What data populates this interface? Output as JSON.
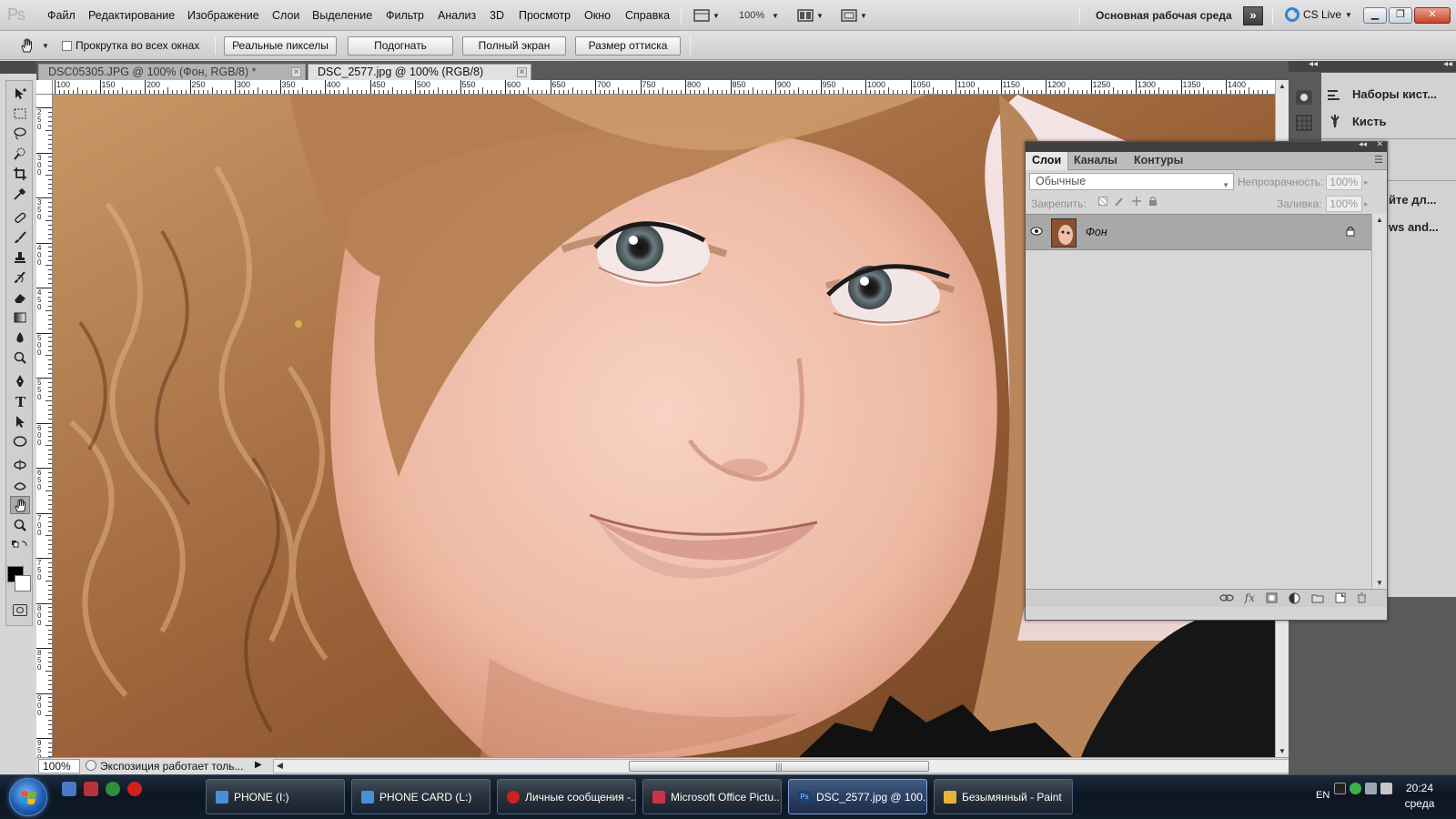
{
  "app": {
    "logo": "Ps"
  },
  "menu": [
    "Файл",
    "Редактирование",
    "Изображение",
    "Слои",
    "Выделение",
    "Фильтр",
    "Анализ",
    "3D",
    "Просмотр",
    "Окно",
    "Справка"
  ],
  "menubar": {
    "zoom": "100%",
    "workspace": "Основная рабочая среда",
    "cslive": "CS Live"
  },
  "options": {
    "scroll_all_label": "Прокрутка во всех окнах",
    "buttons": [
      "Реальные пикселы",
      "Подогнать",
      "Полный экран",
      "Размер оттиска"
    ]
  },
  "tabs": [
    {
      "title": "DSC05305.JPG @ 100% (Фон, RGB/8) *",
      "active": false
    },
    {
      "title": "DSC_2577.jpg @ 100% (RGB/8)",
      "active": true
    }
  ],
  "ruler": {
    "top": [
      "100",
      "150",
      "200",
      "250",
      "300",
      "350",
      "400",
      "450",
      "500",
      "550",
      "600",
      "650",
      "700",
      "750",
      "800",
      "850",
      "900",
      "950",
      "1000",
      "1050",
      "1100",
      "1150",
      "1200",
      "1250",
      "1300",
      "1350",
      "1400"
    ],
    "left": [
      "2\n5\n0",
      "3\n0\n0",
      "3\n5\n0",
      "4\n0\n0",
      "4\n5\n0",
      "5\n0\n0",
      "5\n5\n0",
      "6\n0\n0",
      "6\n5\n0",
      "7\n0\n0",
      "7\n5\n0",
      "8\n0\n0",
      "8\n5\n0",
      "9\n0\n0",
      "9\n5\n0"
    ]
  },
  "status": {
    "zoom": "100%",
    "text": "Экспозиция работает толь..."
  },
  "dock": {
    "items": [
      "Наборы кист...",
      "Кисть"
    ],
    "cut_texts": [
      "йте дл...",
      "ws and..."
    ]
  },
  "layers": {
    "tabs": [
      "Слои",
      "Каналы",
      "Контуры"
    ],
    "blend_mode": "Обычные",
    "opacity_label": "Непрозрачность:",
    "opacity": "100%",
    "lock_label": "Закрепить:",
    "fill_label": "Заливка:",
    "fill": "100%",
    "layer_name": "Фон"
  },
  "taskbar": {
    "items": [
      {
        "label": "PHONE (I:)",
        "color": "#4a8fd8",
        "active": false
      },
      {
        "label": "PHONE CARD (L:)",
        "color": "#4a8fd8",
        "active": false
      },
      {
        "label": "Личные сообщения -...",
        "color": "#d22020",
        "active": false
      },
      {
        "label": "Microsoft Office Pictu...",
        "color": "#c8344a",
        "active": false
      },
      {
        "label": "DSC_2577.jpg @ 100...",
        "color": "#1d3f78",
        "active": true
      },
      {
        "label": "Безымянный - Paint",
        "color": "#e7b43a",
        "active": false
      }
    ],
    "lang": "EN",
    "time": "20:24",
    "day": "среда"
  }
}
